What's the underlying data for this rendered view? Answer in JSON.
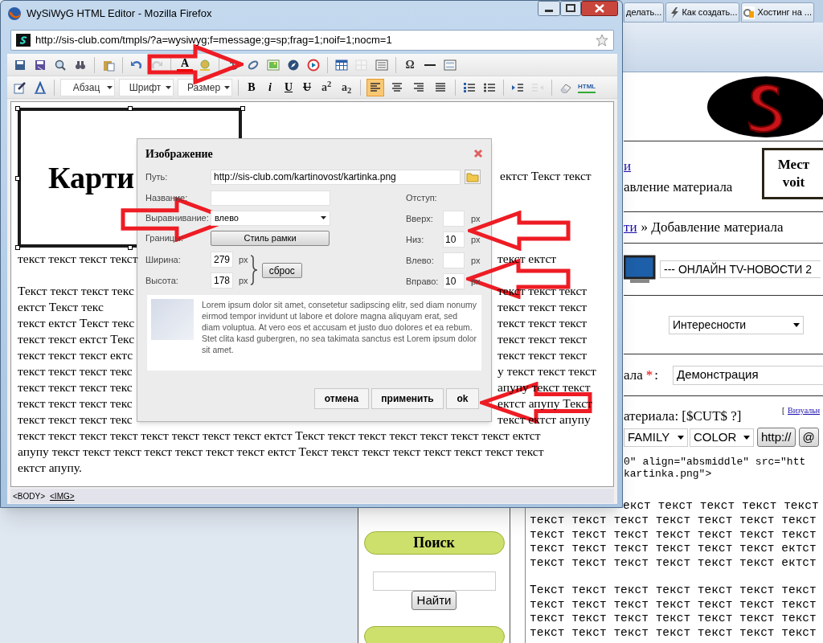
{
  "background_browser": {
    "tabs": [
      {
        "label": "делать..."
      },
      {
        "label": "Как создать..."
      },
      {
        "label": "Хостинг на ..."
      }
    ],
    "header_box": [
      "Мест",
      "voit"
    ],
    "breadcrumb_top": {
      "link": "и",
      "text": "авление материала"
    },
    "breadcrumb": {
      "link": "ти",
      "text": "» Добавление материала"
    },
    "channel_select": "--- ОНЛАЙН TV-НОВОСТИ 2",
    "category_select": "Интересности",
    "title_field": {
      "label": "ала",
      "required_mark": "*",
      "label_end": ":",
      "value": "Демонстрация"
    },
    "body_label": "атериала: [$CUT$ ?]",
    "visual_link": {
      "bracket": "[",
      "link": "Визуальн"
    },
    "format_selects": [
      "FAMILY",
      "COLOR"
    ],
    "format_buttons": [
      "http://",
      "@"
    ],
    "code_lines": [
      "0\" align=\"absmiddle\" src=\"htt",
      "kartinka.png\">"
    ],
    "text_first_line": "екст текст текст текст текст",
    "text_lines": [
      "текст текст текст текст текст текст текст",
      "текст текст текст текст текст текст текст",
      "текст текст текст текст текст текст ектст",
      "текст текст текст текст текст текст ектст"
    ],
    "text_lines_2": [
      "Текст текст текст текст текст текст текст",
      "текст текст текст текст текст текст текст",
      "текст текст текст текст текст текст текст",
      "текст текст текст текст текст текст текст"
    ],
    "sidebar": {
      "title": "Поиск",
      "button": "Найти"
    }
  },
  "window": {
    "title": "WySiWyG HTML Editor - Mozilla Firefox",
    "url": "http://sis-club.com/tmpls/?a=wysiwyg;f=message;g=sp;frag=1;noif=1;nocm=1"
  },
  "toolbar_row_1": [
    {
      "kind": "icon",
      "disabled": false
    },
    {
      "kind": "icon",
      "disabled": false
    },
    {
      "kind": "icon",
      "disabled": false
    },
    {
      "kind": "icon",
      "disabled": false
    },
    {
      "kind": "separator"
    },
    {
      "kind": "icon",
      "disabled": false
    },
    {
      "kind": "separator"
    },
    {
      "kind": "icon",
      "disabled": false
    },
    {
      "kind": "icon",
      "disabled": true
    },
    {
      "kind": "separator"
    },
    {
      "kind": "font-color",
      "label": "A"
    },
    {
      "kind": "icon",
      "disabled": false
    },
    {
      "kind": "separator"
    },
    {
      "kind": "icon",
      "disabled": false
    },
    {
      "kind": "icon",
      "disabled": false
    },
    {
      "kind": "icon",
      "disabled": false
    },
    {
      "kind": "icon",
      "disabled": false
    },
    {
      "kind": "icon",
      "disabled": false
    },
    {
      "kind": "separator"
    },
    {
      "kind": "icon",
      "disabled": false
    },
    {
      "kind": "icon",
      "disabled": true
    },
    {
      "kind": "icon",
      "disabled": false
    },
    {
      "kind": "separator"
    },
    {
      "kind": "text",
      "label": "Ω"
    },
    {
      "kind": "icon",
      "disabled": false
    },
    {
      "kind": "icon",
      "disabled": false
    }
  ],
  "toolbar_row_2": [
    {
      "kind": "icon",
      "disabled": false
    },
    {
      "kind": "icon",
      "disabled": false
    },
    {
      "kind": "separator"
    },
    {
      "kind": "select",
      "label": "Абзац"
    },
    {
      "kind": "select",
      "label": "Шрифт"
    },
    {
      "kind": "select",
      "label": "Размер"
    },
    {
      "kind": "separator"
    },
    {
      "kind": "bold",
      "label": "B"
    },
    {
      "kind": "italic",
      "label": "i"
    },
    {
      "kind": "underline",
      "label": "U"
    },
    {
      "kind": "strike",
      "label": "U"
    },
    {
      "kind": "text",
      "label": "a$^{2}$"
    },
    {
      "kind": "text",
      "label": "a$_{2}$"
    },
    {
      "kind": "separator"
    },
    {
      "kind": "align",
      "selected": true
    },
    {
      "kind": "align",
      "selected": false
    },
    {
      "kind": "align",
      "selected": false
    },
    {
      "kind": "align",
      "selected": false
    },
    {
      "kind": "separator"
    },
    {
      "kind": "icon",
      "disabled": false
    },
    {
      "kind": "icon",
      "disabled": false
    },
    {
      "kind": "separator"
    },
    {
      "kind": "icon",
      "disabled": false
    },
    {
      "kind": "icon",
      "disabled": true
    },
    {
      "kind": "separator"
    },
    {
      "kind": "icon",
      "disabled": false
    },
    {
      "kind": "html",
      "label": "HTML"
    }
  ],
  "editor": {
    "image_caption": "Карти",
    "float_line": "ектст Текст текст",
    "row_under_image": {
      "left": "текст текст текст текст",
      "right": "текст ектст"
    },
    "rows": [
      {
        "left": "Текст текст текст текс",
        "right": "текст текст текст"
      },
      {
        "left": "ектст Текст текс",
        "right": "текст текст текст"
      },
      {
        "left": "текст ектст Текст текс",
        "right": "текст текст текст"
      },
      {
        "left": "текст текст ектст Текс",
        "right": "текст текст текст"
      },
      {
        "left": "текст текст текст ектс",
        "right": "текст текст текст"
      },
      {
        "left": "текст текст текст текс",
        "right": "у текст текст текст"
      },
      {
        "left": "текст текст текст текс",
        "right": "апупу текст текст"
      },
      {
        "left": "текст текст текст текс",
        "right": "ектст апупу Текст"
      },
      {
        "left": "текст текст текст текс",
        "right": "текст ектст апупу"
      }
    ],
    "full_lines": [
      "текст текст текст текст текст текст текст текст ектст Текст текст текст текст текст текст текст ектст",
      "апупу текст текст текст текст текст текст текст ектст Текст текст текст текст текст текст текст текст",
      "ектст апупу."
    ]
  },
  "status_bar": [
    "<BODY>",
    "<IMG>"
  ],
  "dialog": {
    "title": "Изображение",
    "path": {
      "label": "Путь:",
      "value": "http://sis-club.com/kartinovost/kartinka.png"
    },
    "name": {
      "label": "Название:"
    },
    "align": {
      "label": "Выравнивание:",
      "value": "влево"
    },
    "border": {
      "label": "Границы:",
      "button": "Стиль рамки"
    },
    "width": {
      "label": "Ширина:",
      "value": "279",
      "unit": "px"
    },
    "height": {
      "label": "Высота:",
      "value": "178",
      "unit": "px"
    },
    "reset": "сброс",
    "margin_title": "Отступ:",
    "margins": [
      {
        "label": "Вверх:",
        "unit": "px"
      },
      {
        "label": "Низ:",
        "value": "10",
        "unit": "px"
      },
      {
        "label": "Влево:",
        "unit": "px"
      },
      {
        "label": "Вправо:",
        "value": "10",
        "unit": "px"
      }
    ],
    "preview_text": "Lorem ipsum dolor sit amet, consetetur sadipscing elitr, sed diam nonumy eirmod tempor invidunt ut labore et dolore magna aliquyam erat, sed diam voluptua. At vero eos et accusam et justo duo dolores et ea rebum. Stet clita kasd gubergren, no sea takimata sanctus est Lorem ipsum dolor sit amet.",
    "buttons": [
      "отмена",
      "применить",
      "ok"
    ]
  }
}
